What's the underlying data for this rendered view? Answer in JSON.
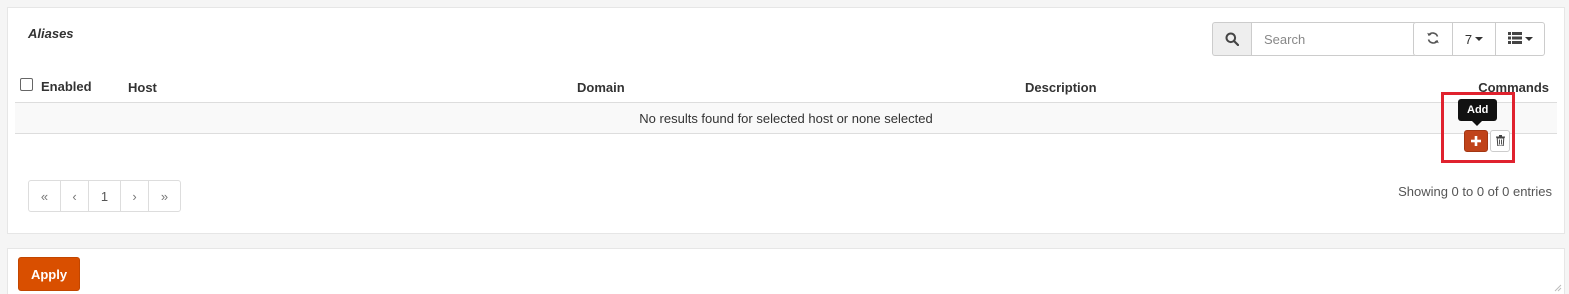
{
  "panel": {
    "title": "Aliases"
  },
  "search": {
    "placeholder": "Search",
    "icon": "search-icon"
  },
  "toolbar": {
    "refresh_icon": "refresh-icon",
    "page_size": "7",
    "columns_icon": "list-icon"
  },
  "table": {
    "headers": {
      "enabled": "Enabled",
      "host": "Host",
      "domain": "Domain",
      "description": "Description",
      "commands": "Commands"
    },
    "empty_message": "No results found for selected host or none selected"
  },
  "commands": {
    "add_tooltip": "Add",
    "add_icon": "plus-icon",
    "delete_icon": "trash-icon"
  },
  "pagination": {
    "first": "«",
    "prev": "‹",
    "current": "1",
    "next": "›",
    "last": "»"
  },
  "info": "Showing 0 to 0 of 0 entries",
  "footer": {
    "apply_label": "Apply"
  },
  "colors": {
    "add_button": "#c0431a",
    "apply_button": "#d94f00",
    "highlight": "#e0222e"
  }
}
